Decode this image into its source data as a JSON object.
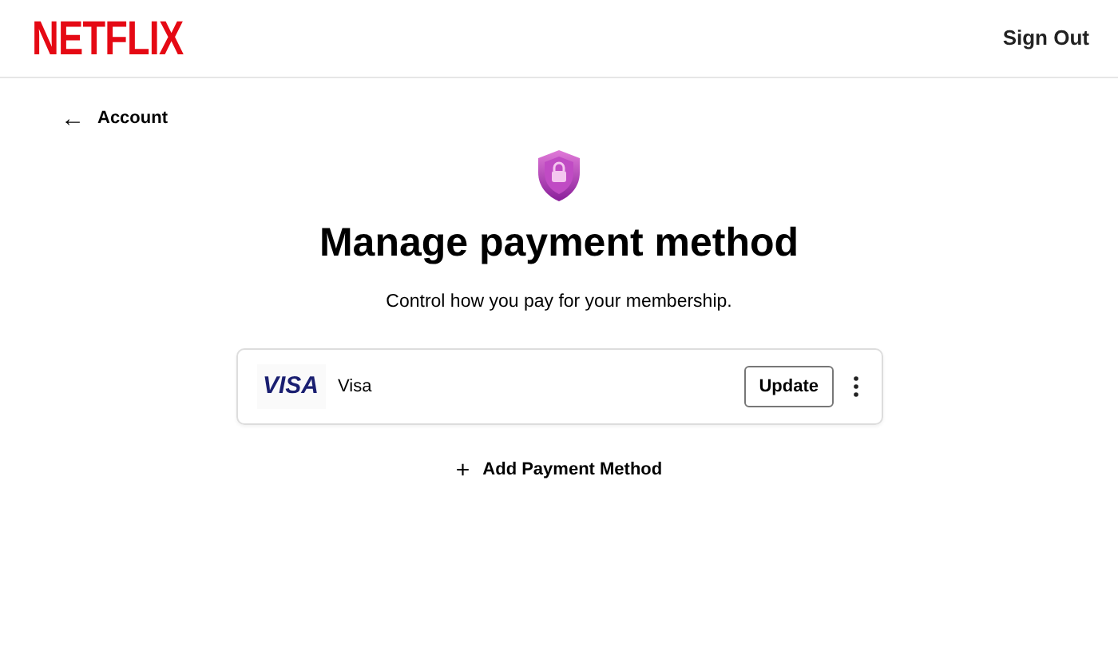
{
  "header": {
    "logo": "NETFLIX",
    "sign_out": "Sign Out"
  },
  "back_link": {
    "arrow": "←",
    "label": "Account"
  },
  "title": "Manage payment method",
  "subtitle": "Control how you pay for your membership.",
  "payment_methods": [
    {
      "brand_logo": "VISA",
      "name": "Visa",
      "button": "Update"
    }
  ],
  "add_link": {
    "icon": "+",
    "label": "Add Payment Method"
  }
}
